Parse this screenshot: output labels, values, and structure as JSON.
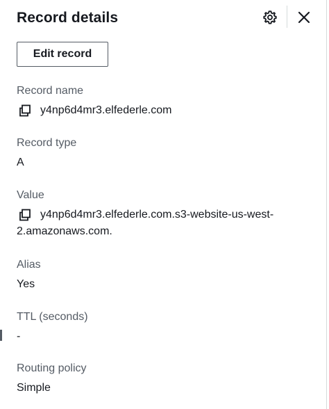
{
  "panel": {
    "title": "Record details",
    "settings_icon": "gear-icon",
    "close_icon": "close-icon",
    "edit_button_label": "Edit record"
  },
  "fields": {
    "record_name": {
      "label": "Record name",
      "value": "y4np6d4mr3.elfederle.com",
      "icon": "copy-icon"
    },
    "record_type": {
      "label": "Record type",
      "value": "A"
    },
    "value": {
      "label": "Value",
      "value_line1": "y4np6d4mr3.elfederle.com.s3-website-us-west-",
      "value_line2": "2.amazonaws.com.",
      "icon": "copy-icon"
    },
    "alias": {
      "label": "Alias",
      "value": "Yes"
    },
    "ttl": {
      "label": "TTL (seconds)",
      "value": "-"
    },
    "routing_policy": {
      "label": "Routing policy",
      "value": "Simple"
    }
  },
  "colors": {
    "text": "#16191f",
    "label": "#545b64",
    "border": "#d5dbdb"
  }
}
